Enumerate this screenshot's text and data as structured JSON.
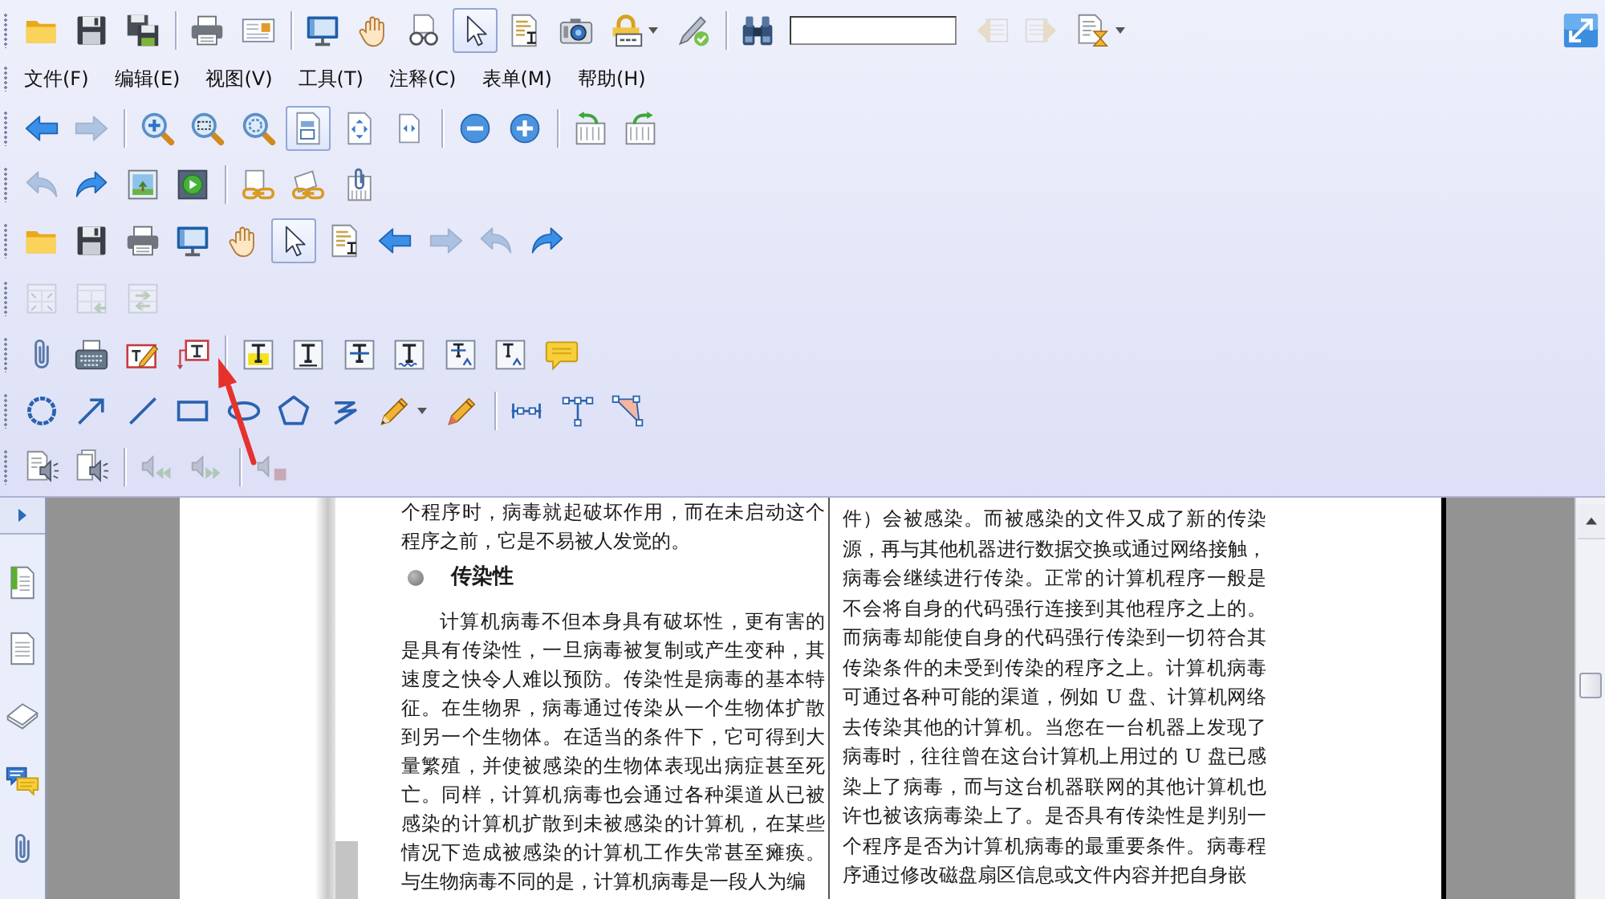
{
  "top_toolbar": {
    "groups": [
      [
        {
          "kind": "button",
          "selected": false,
          "disabled": false
        },
        {
          "kind": "button",
          "selected": false,
          "disabled": false
        },
        {
          "kind": "button",
          "selected": false,
          "disabled": false
        }
      ],
      [
        {
          "kind": "button",
          "selected": false,
          "disabled": false
        },
        {
          "kind": "button",
          "selected": false,
          "disabled": false
        }
      ],
      [
        {
          "kind": "button",
          "selected": false,
          "disabled": false
        },
        {
          "kind": "button",
          "selected": false,
          "disabled": false
        },
        {
          "kind": "button",
          "selected": false,
          "disabled": false
        },
        {
          "kind": "button",
          "selected": true,
          "disabled": false
        },
        {
          "kind": "button",
          "selected": false,
          "disabled": false
        },
        {
          "kind": "button",
          "selected": false,
          "disabled": false
        },
        {
          "kind": "button",
          "selected": false,
          "disabled": false
        },
        {
          "kind": "button",
          "selected": false,
          "disabled": false
        }
      ],
      [
        {
          "kind": "button",
          "selected": false,
          "disabled": false
        },
        {
          "kind": "search"
        },
        {
          "kind": "button",
          "selected": false,
          "disabled": true
        },
        {
          "kind": "button",
          "selected": false,
          "disabled": true
        },
        {
          "kind": "button",
          "selected": false,
          "disabled": false
        }
      ]
    ]
  },
  "menu_bar": [
    "文件(F)",
    "编辑(E)",
    "视图(V)",
    "工具(T)",
    "注释(C)",
    "表单(M)",
    "帮助(H)"
  ],
  "toolbars": [
    {
      "groups": [
        [
          {
            "selected": false,
            "disabled": false
          },
          {
            "selected": false,
            "disabled": true
          }
        ],
        [
          {
            "selected": false,
            "disabled": false
          },
          {
            "selected": false,
            "disabled": false
          },
          {
            "selected": false,
            "disabled": false
          },
          {
            "selected": true,
            "disabled": false
          },
          {
            "selected": false,
            "disabled": false
          },
          {
            "selected": false,
            "disabled": false
          }
        ],
        [
          {
            "selected": false,
            "disabled": false
          },
          {
            "selected": false,
            "disabled": false
          }
        ],
        [
          {
            "selected": false,
            "disabled": false
          },
          {
            "selected": false,
            "disabled": false
          }
        ]
      ]
    },
    {
      "groups": [
        [
          {
            "selected": false,
            "disabled": true
          },
          {
            "selected": false,
            "disabled": false
          },
          {
            "selected": false,
            "disabled": false
          },
          {
            "selected": false,
            "disabled": false
          }
        ],
        [
          {
            "selected": false,
            "disabled": false
          },
          {
            "selected": false,
            "disabled": false
          },
          {
            "selected": false,
            "disabled": false
          }
        ]
      ]
    },
    {
      "groups": [
        [
          {
            "selected": false,
            "disabled": false
          },
          {
            "selected": false,
            "disabled": false
          },
          {
            "selected": false,
            "disabled": false
          },
          {
            "selected": false,
            "disabled": false
          },
          {
            "selected": false,
            "disabled": false
          },
          {
            "selected": true,
            "disabled": false
          },
          {
            "selected": false,
            "disabled": false
          },
          {
            "selected": false,
            "disabled": false
          },
          {
            "selected": false,
            "disabled": true
          },
          {
            "selected": false,
            "disabled": true
          },
          {
            "selected": false,
            "disabled": false
          }
        ]
      ]
    },
    {
      "groups": [
        [
          {
            "selected": false,
            "disabled": true
          },
          {
            "selected": false,
            "disabled": true
          },
          {
            "selected": false,
            "disabled": true
          }
        ]
      ]
    },
    {
      "groups": [
        [
          {
            "selected": false,
            "disabled": false
          },
          {
            "selected": false,
            "disabled": false
          },
          {
            "selected": false,
            "disabled": false
          },
          {
            "selected": false,
            "disabled": false
          }
        ],
        [
          {
            "selected": false,
            "disabled": false
          },
          {
            "selected": false,
            "disabled": false
          },
          {
            "selected": false,
            "disabled": false
          },
          {
            "selected": false,
            "disabled": false
          },
          {
            "selected": false,
            "disabled": false
          },
          {
            "selected": false,
            "disabled": false
          },
          {
            "selected": false,
            "disabled": false
          }
        ]
      ]
    },
    {
      "groups": [
        [
          {
            "selected": false,
            "disabled": false
          },
          {
            "selected": false,
            "disabled": false
          },
          {
            "selected": false,
            "disabled": false
          },
          {
            "selected": false,
            "disabled": false
          },
          {
            "selected": false,
            "disabled": false
          },
          {
            "selected": false,
            "disabled": false
          },
          {
            "selected": false,
            "disabled": false
          },
          {
            "selected": false,
            "disabled": false
          },
          {
            "selected": false,
            "disabled": false
          }
        ],
        [
          {
            "selected": false,
            "disabled": false
          },
          {
            "selected": false,
            "disabled": false
          },
          {
            "selected": false,
            "disabled": false
          }
        ]
      ]
    },
    {
      "groups": [
        [
          {
            "selected": false,
            "disabled": false
          },
          {
            "selected": false,
            "disabled": false
          }
        ],
        [
          {
            "selected": false,
            "disabled": true
          },
          {
            "selected": false,
            "disabled": true
          }
        ],
        [
          {
            "selected": false,
            "disabled": true
          }
        ]
      ]
    }
  ],
  "document": {
    "columns": [
      {
        "blocks": [
          {
            "kind": "paragraph",
            "indented": false,
            "lines": [
              "个程序时，病毒就起破坏作用，而在未启动这个",
              "程序之前，它是不易被人发觉的。"
            ]
          },
          {
            "kind": "heading",
            "text": "传染性"
          },
          {
            "kind": "paragraph",
            "indented": true,
            "lines": [
              "计算机病毒不但本身具有破坏性，更有害的",
              "是具有传染性，一旦病毒被复制或产生变种，其",
              "速度之快令人难以预防。传染性是病毒的基本特",
              "征。在生物界，病毒通过传染从一个生物体扩散",
              "到另一个生物体。在适当的条件下，它可得到大",
              "量繁殖，并使被感染的生物体表现出病症甚至死",
              "亡。同样，计算机病毒也会通过各种渠道从已被",
              "感染的计算机扩散到未被感染的计算机，在某些",
              "情况下造成被感染的计算机工作失常甚至瘫痪。",
              "与生物病毒不同的是，计算机病毒是一段人为编"
            ]
          }
        ]
      },
      {
        "blocks": [
          {
            "kind": "paragraph",
            "indented": false,
            "lines": [
              "件）会被感染。而被感染的文件又成了新的传染",
              "源，再与其他机器进行数据交换或通过网络接触，",
              "病毒会继续进行传染。正常的计算机程序一般是",
              "不会将自身的代码强行连接到其他程序之上的。",
              "而病毒却能使自身的代码强行传染到一切符合其",
              "传染条件的未受到传染的程序之上。计算机病毒",
              "可通过各种可能的渠道，例如 U 盘、计算机网络",
              "去传染其他的计算机。当您在一台机器上发现了",
              "病毒时，往往曾在这台计算机上用过的 U 盘已感",
              "染上了病毒，而与这台机器联网的其他计算机也",
              "许也被该病毒染上了。是否具有传染性是判别一",
              "个程序是否为计算机病毒的最重要条件。病毒程",
              "序通过修改磁盘扇区信息或文件内容并把自身嵌"
            ]
          }
        ]
      }
    ]
  }
}
